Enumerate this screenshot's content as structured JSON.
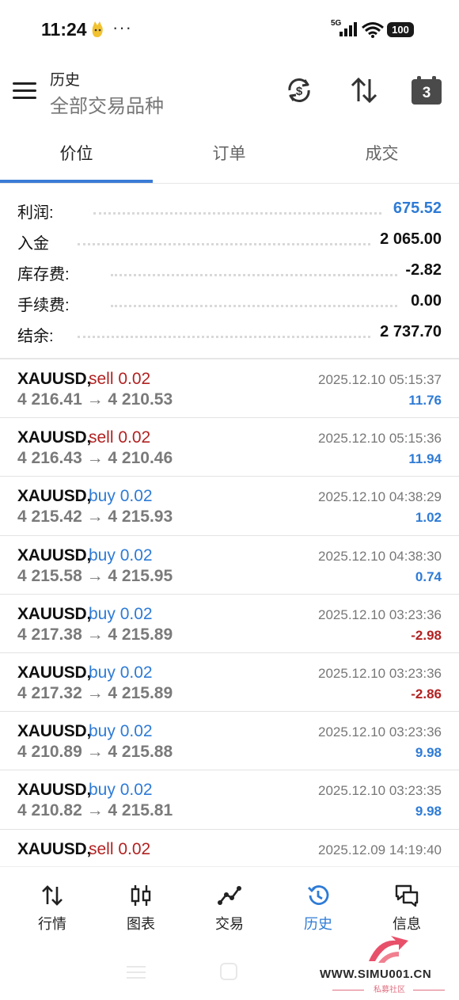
{
  "status_bar": {
    "time": "11:24",
    "dots": "···",
    "network": "5G",
    "battery": "100"
  },
  "header": {
    "title": "历史",
    "subtitle": "全部交易品种",
    "calendar_day": "3"
  },
  "tabs": [
    {
      "label": "价位",
      "active": true
    },
    {
      "label": "订单",
      "active": false
    },
    {
      "label": "成交",
      "active": false
    }
  ],
  "summary": [
    {
      "label": "利润:",
      "value": "675.52",
      "highlight": true
    },
    {
      "label": "入金",
      "value": "2 065.00",
      "highlight": false
    },
    {
      "label": "库存费:",
      "value": "-2.82",
      "highlight": false
    },
    {
      "label": "手续费:",
      "value": "0.00",
      "highlight": false
    },
    {
      "label": "结余:",
      "value": "2 737.70",
      "highlight": false
    }
  ],
  "trades": [
    {
      "symbol": "XAUUSD,",
      "action": "sell 0.02",
      "side": "sell",
      "prices": "4 216.41 → 4 210.53",
      "time": "2025.12.10 05:15:37",
      "profit": "11.76",
      "profit_sign": "pos"
    },
    {
      "symbol": "XAUUSD,",
      "action": "sell 0.02",
      "side": "sell",
      "prices": "4 216.43 → 4 210.46",
      "time": "2025.12.10 05:15:36",
      "profit": "11.94",
      "profit_sign": "pos"
    },
    {
      "symbol": "XAUUSD,",
      "action": "buy 0.02",
      "side": "buy",
      "prices": "4 215.42 → 4 215.93",
      "time": "2025.12.10 04:38:29",
      "profit": "1.02",
      "profit_sign": "pos"
    },
    {
      "symbol": "XAUUSD,",
      "action": "buy 0.02",
      "side": "buy",
      "prices": "4 215.58 → 4 215.95",
      "time": "2025.12.10 04:38:30",
      "profit": "0.74",
      "profit_sign": "pos"
    },
    {
      "symbol": "XAUUSD,",
      "action": "buy 0.02",
      "side": "buy",
      "prices": "4 217.38 → 4 215.89",
      "time": "2025.12.10 03:23:36",
      "profit": "-2.98",
      "profit_sign": "neg"
    },
    {
      "symbol": "XAUUSD,",
      "action": "buy 0.02",
      "side": "buy",
      "prices": "4 217.32 → 4 215.89",
      "time": "2025.12.10 03:23:36",
      "profit": "-2.86",
      "profit_sign": "neg"
    },
    {
      "symbol": "XAUUSD,",
      "action": "buy 0.02",
      "side": "buy",
      "prices": "4 210.89 → 4 215.88",
      "time": "2025.12.10 03:23:36",
      "profit": "9.98",
      "profit_sign": "pos"
    },
    {
      "symbol": "XAUUSD,",
      "action": "buy 0.02",
      "side": "buy",
      "prices": "4 210.82 → 4 215.81",
      "time": "2025.12.10 03:23:35",
      "profit": "9.98",
      "profit_sign": "pos"
    },
    {
      "symbol": "XAUUSD,",
      "action": "sell 0.02",
      "side": "sell",
      "prices": "",
      "time": "2025.12.09 14:19:40",
      "profit": "",
      "profit_sign": "pos"
    }
  ],
  "bottom_nav": [
    {
      "label": "行情",
      "icon": "quotes-arrows-icon",
      "active": false
    },
    {
      "label": "图表",
      "icon": "candlestick-chart-icon",
      "active": false
    },
    {
      "label": "交易",
      "icon": "trade-line-icon",
      "active": false
    },
    {
      "label": "历史",
      "icon": "history-clock-icon",
      "active": true
    },
    {
      "label": "信息",
      "icon": "messages-icon",
      "active": false
    }
  ],
  "watermark": {
    "url": "WWW.SIMU001.CN",
    "sub": "私募社区"
  },
  "colors": {
    "accent": "#2e7bd6",
    "sell": "#b22222",
    "muted": "#7a7a7a"
  }
}
